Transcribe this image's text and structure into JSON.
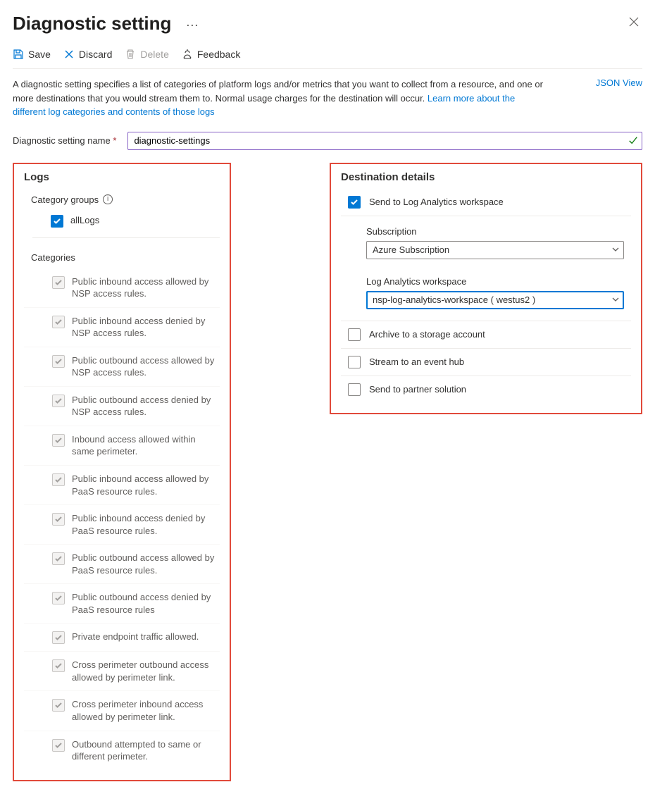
{
  "header": {
    "title": "Diagnostic setting",
    "more": "⋯"
  },
  "toolbar": {
    "save": "Save",
    "discard": "Discard",
    "delete": "Delete",
    "feedback": "Feedback"
  },
  "description": {
    "text1": "A diagnostic setting specifies a list of categories of platform logs and/or metrics that you want to collect from a resource, and one or more destinations that you would stream them to. Normal usage charges for the destination will occur. ",
    "link": "Learn more about the different log categories and contents of those logs",
    "json_view": "JSON View"
  },
  "name_field": {
    "label": "Diagnostic setting name",
    "value": "diagnostic-settings"
  },
  "logs": {
    "title": "Logs",
    "category_groups_label": "Category groups",
    "all_logs": "allLogs",
    "categories_label": "Categories",
    "categories": [
      "Public inbound access allowed by NSP access rules.",
      "Public inbound access denied by NSP access rules.",
      "Public outbound access allowed by NSP access rules.",
      "Public outbound access denied by NSP access rules.",
      "Inbound access allowed within same perimeter.",
      "Public inbound access allowed by PaaS resource rules.",
      "Public inbound access denied by PaaS resource rules.",
      "Public outbound access allowed by PaaS resource rules.",
      "Public outbound access denied by PaaS resource rules",
      "Private endpoint traffic allowed.",
      "Cross perimeter outbound access allowed by perimeter link.",
      "Cross perimeter inbound access allowed by perimeter link.",
      "Outbound attempted to same or different perimeter."
    ]
  },
  "destination": {
    "title": "Destination details",
    "send_law": "Send to Log Analytics workspace",
    "subscription_label": "Subscription",
    "subscription_value": "Azure Subscription",
    "law_label": "Log Analytics workspace",
    "law_value": "nsp-log-analytics-workspace ( westus2 )",
    "archive": "Archive to a storage account",
    "eventhub": "Stream to an event hub",
    "partner": "Send to partner solution"
  }
}
